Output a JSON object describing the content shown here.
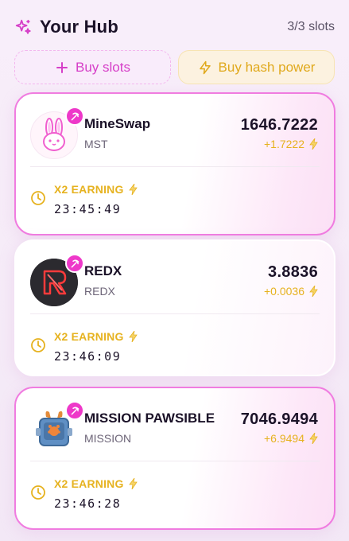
{
  "header": {
    "title": "Your Hub",
    "slots": "3/3 slots",
    "accent": "#d63fc8"
  },
  "actions": {
    "buy_slots": "Buy slots",
    "buy_hash_power": "Buy hash power"
  },
  "cards": [
    {
      "name": "MineSwap",
      "symbol": "MST",
      "balance": "1646.7222",
      "delta": "+1.7222",
      "earning_label": "X2 EARNING",
      "timer": "23:45:49",
      "logo": "bunny-logo",
      "active": true
    },
    {
      "name": "REDX",
      "symbol": "REDX",
      "balance": "3.8836",
      "delta": "+0.0036",
      "earning_label": "X2 EARNING",
      "timer": "23:46:09",
      "logo": "redx-logo",
      "active": false
    },
    {
      "name": "MISSION PAWSIBLE",
      "symbol": "MISSION",
      "balance": "7046.9494",
      "delta": "+6.9494",
      "earning_label": "X2 EARNING",
      "timer": "23:46:28",
      "logo": "mission-box-logo",
      "active": true
    }
  ],
  "colors": {
    "pink": "#ee38c9",
    "gold": "#e6b21f"
  }
}
